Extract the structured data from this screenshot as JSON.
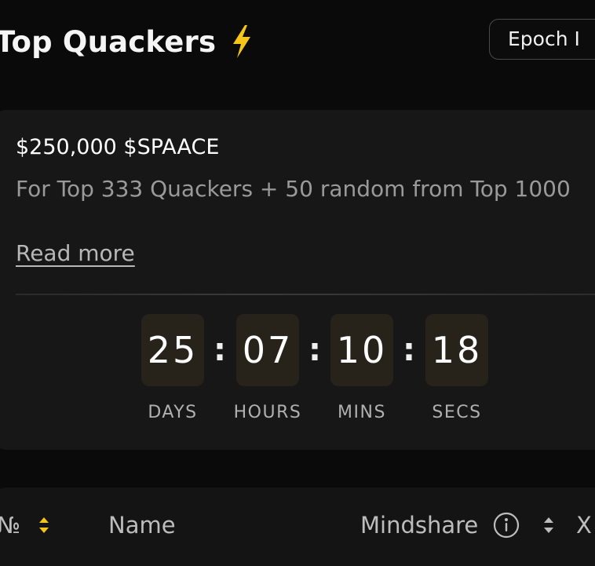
{
  "header": {
    "title": "Top Quackers",
    "title_icon": "lightning-bolt-icon",
    "epoch_label": "Epoch I"
  },
  "reward": {
    "amount": "$250,000 $SPAACE",
    "description": "For Top 333 Quackers + 50 random from Top 1000",
    "read_more": "Read more"
  },
  "countdown": {
    "days": "25",
    "hours": "07",
    "mins": "10",
    "secs": "18",
    "separator": ":",
    "labels": {
      "days": "DAYS",
      "hours": "HOURS",
      "mins": "MINS",
      "secs": "SECS"
    }
  },
  "table": {
    "columns": {
      "rank": "№",
      "name": "Name",
      "mindshare": "Mindshare",
      "next": "X"
    }
  },
  "colors": {
    "background": "#0a0a0a",
    "card": "#171717",
    "accent_yellow": "#f5c518",
    "countdown_box": "#27231a",
    "muted_text": "#9a9a9a"
  }
}
